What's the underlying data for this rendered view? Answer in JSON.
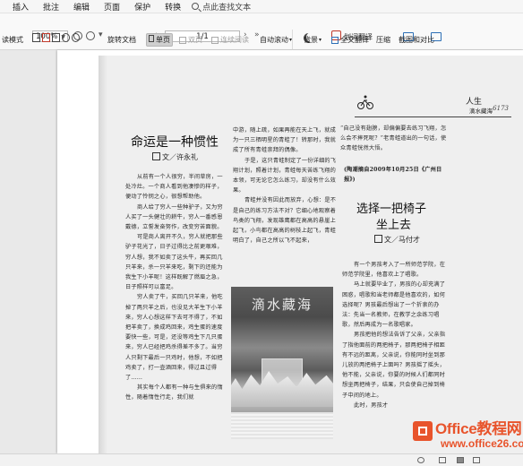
{
  "menu": {
    "items": [
      "插入",
      "批注",
      "编辑",
      "页面",
      "保护",
      "转换"
    ],
    "search_label": "点此查找文本"
  },
  "toolbar": {
    "zoom_value": "100%",
    "page_value": "1/1",
    "left_label": "读模式",
    "rotate_label": "旋转文档",
    "single_page": "单页",
    "double_page": "双页",
    "continuous": "连续阅读",
    "auto_scroll": "自动滚动",
    "background": "背景",
    "translate_word": "划词翻译",
    "translate_full": "全文翻译",
    "compress": "压缩",
    "screenshot_compare": "截图和对比"
  },
  "document": {
    "title1": "命运是一种惯性",
    "byline1": "文／许永礼",
    "col1_paragraphs": [
      "从前有一个人很穷，半间草房，一处冷灶。一个商人看到他凄惨的样子，便动了怜悯之心，很想帮助他。",
      "商人给了穷人一些种驴子，又为穷人买了一头健壮的耕牛，穷人一番感恩戴德，立誓发奋努作，改变穷苦面貌。",
      "可是商人离开不久，穷人就把那些驴子花光了，日子过得比之前更艰难，穷人想，我不如卖了这头牛，再买回几只羊来，杀一只羊来吃，剩下的还能为我生下小羊呢！这样既解了燃眉之急，日子照样可以富足。",
      "穷人卖了牛，买回几只羊来，他吃掉了两只羊之后，也没见大羊生下小羊来，穷人心想这样下去可不得了，不如把羊卖了，换成鸡回来，鸡生蛋的速度要快一些，可是，还没等鸡生下几只蛋来，穷人已经把鸡杀得差不多了。当穷人只剩下最后一只鸡时，他想，不如把鸡卖了，打一壶酒回来，得过且过得了……",
      "其实每个人都有一种与生俱来的惰性，随着惰性行走，我们就"
    ],
    "col2_paragraphs": [
      "中游，随上疏，如果再能在天上飞，就成为一只三栖明星的青蛙了！转那时，我就成了所有青蛙崇拜的偶像。",
      "于是，这只青蛙制定了一份详细的飞翔计划，照着计划，青蛙每天苦练飞翔的本领，可无论它怎么练习，却没有什么效果。",
      "青蛙并没有因此而放弃，心想：是不是自己的练习方法不对？它细心地观察着鸟类的飞翔，发现雄鹰都在高高的悬崖上起飞，小鸟都在高高的树枝上起飞，青蛙明白了，自己之所以飞不起来，"
    ],
    "poster_title": "滴水藏海",
    "header_right_title": "人生",
    "header_right_sub": "滴水藏海",
    "header_right_page": "6173",
    "col3_paragraphs": [
      "“自己没有翅膀，却偏偏要去练习飞翔，怎么会不摔死呢？”老青蛙道出的一句话，使众青蛙恍然大悟。"
    ],
    "source_note": "(陶潮摘自2009年10月25日《广州日报》)",
    "title2_line1": "选择一把椅子",
    "title2_line2": "坐上去",
    "byline2": "文／马付才",
    "col3b_paragraphs": [
      "有一个男孩考入了一所师范学院，在师范学院里，他喜欢上了唱歌。",
      "马上就要毕业了，男孩的心却充满了困惑，唱歌和当老师都是他喜欢的，如何选择呢？男孩最后想出了一个折衷的办法：先当一名教师，在教学之余练习唱歌，然后再成为一名歌唱家。",
      "男孩把他的想法告诉了父亲，父亲指了指他面前的两把椅子，那两把椅子相距有不远的距离，父亲说，你能同时坐到那儿放的两把椅子上面吗？男孩摇了摇头，他不能，父亲说，你要的时候人们都同时想坐两把椅子，结果，只会使自己掉到椅子中间的地上。",
      "此时，男孩才"
    ]
  },
  "watermark": {
    "brand": "Office",
    "brand_cn": "教程网",
    "url": "www.office26.com"
  },
  "colors": {
    "watermark": "#e8542c",
    "accent_red": "#c0392b",
    "accent_blue": "#2c6fb5"
  }
}
